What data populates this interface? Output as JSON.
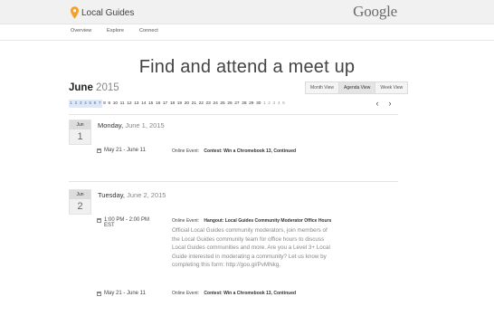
{
  "header": {
    "brand": "Local Guides",
    "company": "Google",
    "colors": {
      "pin": "#f4a02c"
    }
  },
  "nav": {
    "items": [
      "Overview",
      "Explore",
      "Connect"
    ]
  },
  "page": {
    "title": "Find and attend a meet up"
  },
  "calendar": {
    "month": "June",
    "year": "2015",
    "views": [
      "Month View",
      "Agenda View",
      "Week View"
    ],
    "selected_view": "Agenda View",
    "days": [
      "1",
      "2",
      "3",
      "4",
      "5",
      "6",
      "7",
      "8",
      "9",
      "10",
      "11",
      "12",
      "13",
      "14",
      "15",
      "16",
      "17",
      "18",
      "19",
      "20",
      "21",
      "22",
      "23",
      "24",
      "25",
      "26",
      "27",
      "28",
      "29",
      "30",
      "1",
      "2",
      "3",
      "4",
      "5"
    ],
    "prev": "‹",
    "next": "›"
  },
  "agenda": [
    {
      "month_abbr": "Jun",
      "day": "1",
      "weekday": "Monday,",
      "date": "June 1, 2015",
      "events": [
        {
          "time": "May 21 - June 11",
          "label": "Online Event:",
          "title": "Contest: Win a Chromebook 13, Continued"
        }
      ]
    },
    {
      "month_abbr": "Jun",
      "day": "2",
      "weekday": "Tuesday,",
      "date": "June 2, 2015",
      "events": [
        {
          "time": "1:00 PM - 2:00 PM",
          "time2": "EST",
          "label": "Online Event:",
          "title": "Hangout: Local Guides Community Moderator Office Hours",
          "description": [
            "Official Local Guides community moderators, join members of",
            "the Local Guides community team for office hours to discuss",
            "Local Guides communities and more. Are you a Level 3+ Local",
            "Guide interested in moderating a community? Let us know by",
            "completing this form: http://goo.gl/PvMNkg."
          ]
        },
        {
          "time": "May 21 - June 11",
          "label": "Online Event:",
          "title": "Contest: Win a Chromebook 13, Continued"
        }
      ]
    }
  ]
}
